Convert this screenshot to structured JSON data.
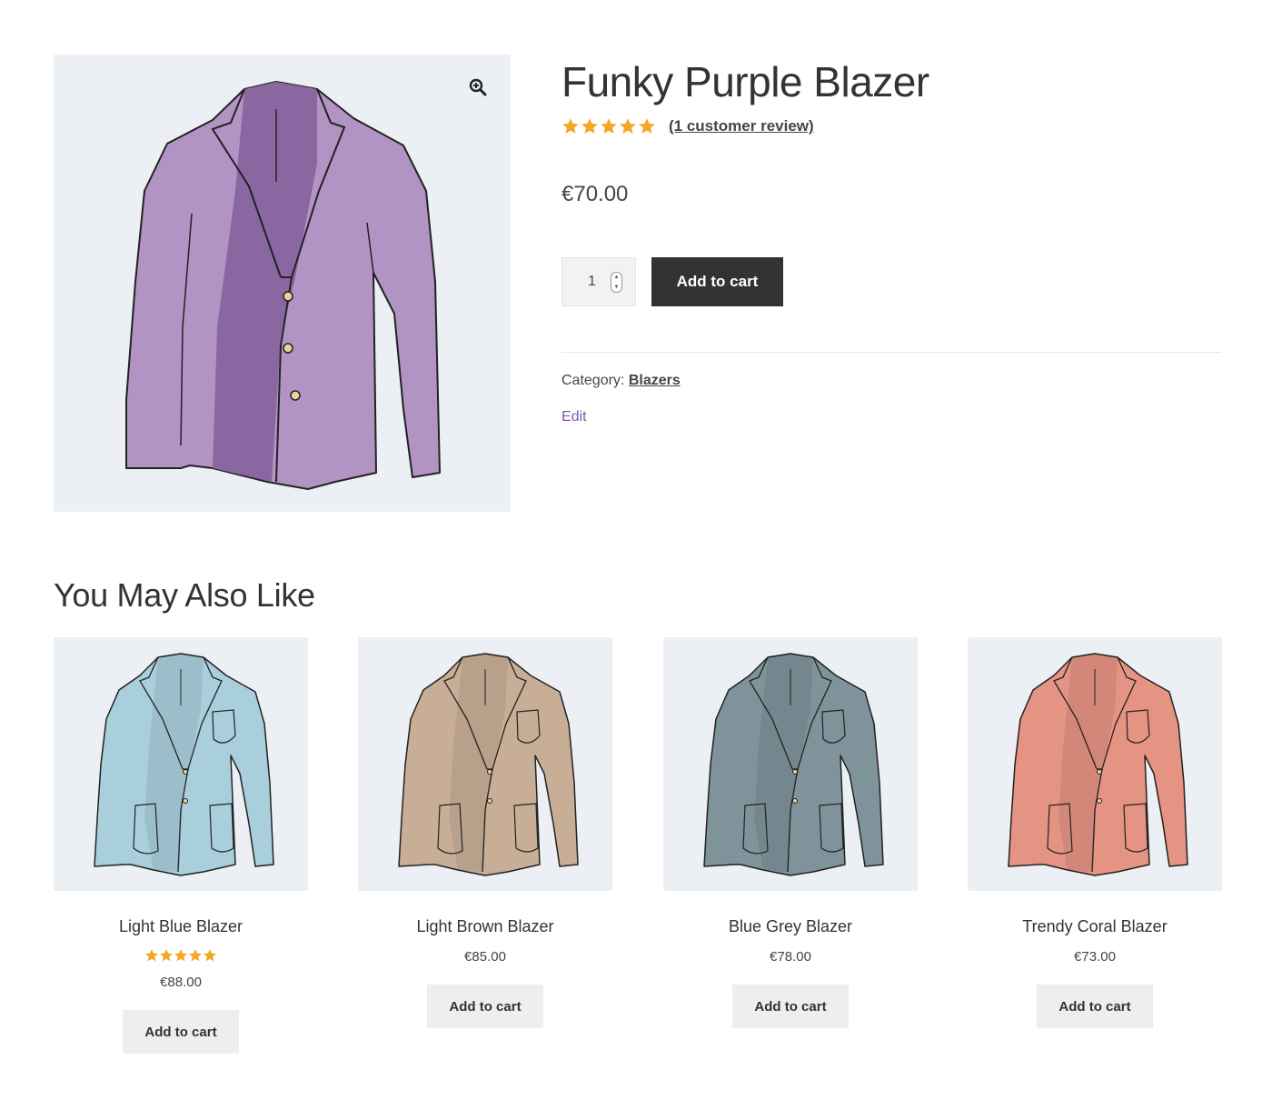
{
  "product": {
    "title": "Funky Purple Blazer",
    "rating": 5,
    "rating_max": 5,
    "review_link": "(1 customer review)",
    "price": "€70.00",
    "quantity": "1",
    "add_to_cart": "Add to cart",
    "category_label": "Category:",
    "category": "Blazers",
    "edit": "Edit",
    "image_icon": "zoom-in-icon",
    "jacket_color": "#b07fbf"
  },
  "related": {
    "heading": "You May Also Like",
    "items": [
      {
        "name": "Light Blue Blazer",
        "price": "€88.00",
        "rating": 5,
        "button": "Add to cart",
        "color": "#a9cfdc"
      },
      {
        "name": "Light Brown Blazer",
        "price": "€85.00",
        "rating": null,
        "button": "Add to cart",
        "color": "#c8ae96"
      },
      {
        "name": "Blue Grey Blazer",
        "price": "€78.00",
        "rating": null,
        "button": "Add to cart",
        "color": "#7f939b"
      },
      {
        "name": "Trendy Coral Blazer",
        "price": "€73.00",
        "rating": null,
        "button": "Add to cart",
        "color": "#e59383"
      }
    ]
  },
  "colors": {
    "star": "#f5a623",
    "dark_button": "#333333",
    "light_button": "#eeeeee",
    "image_bg": "#eceff3",
    "edit_link": "#7f54b3"
  }
}
